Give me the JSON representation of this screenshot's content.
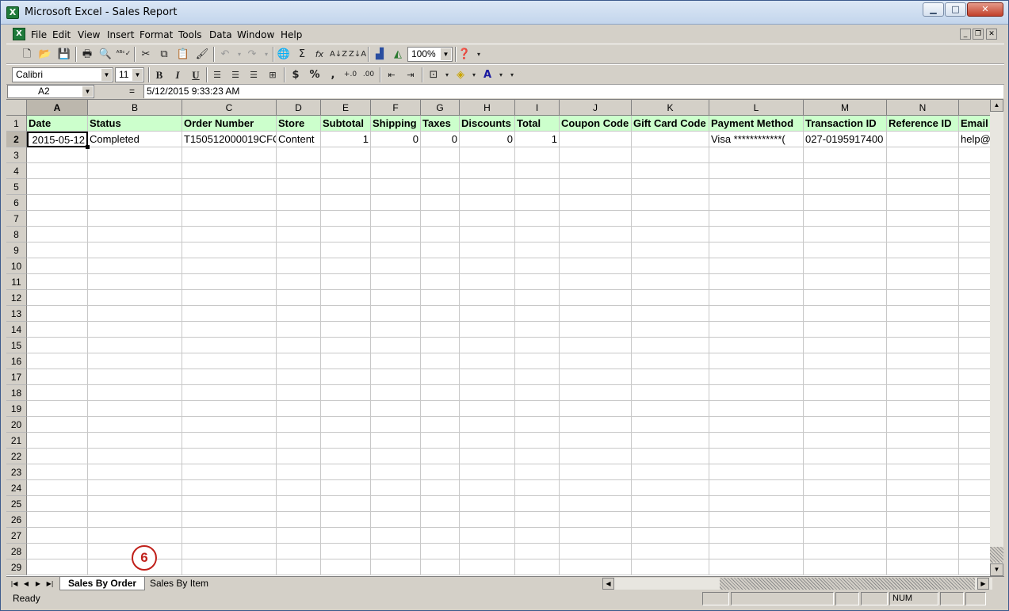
{
  "window": {
    "title": "Microsoft Excel - Sales Report"
  },
  "menu": [
    "File",
    "Edit",
    "View",
    "Insert",
    "Format",
    "Tools",
    "Data",
    "Window",
    "Help"
  ],
  "toolbar": {
    "zoom": "100%",
    "font": "Calibri",
    "font_size": "11"
  },
  "formula_bar": {
    "cell_ref": "A2",
    "equals": "=",
    "value": "5/12/2015  9:33:23 AM"
  },
  "columns": [
    "A",
    "B",
    "C",
    "D",
    "E",
    "F",
    "G",
    "H",
    "I",
    "J",
    "K",
    "L",
    "M",
    "N",
    ""
  ],
  "header_row": [
    "Date",
    "Status",
    "Order Number",
    "Store",
    "Subtotal",
    "Shipping",
    "Taxes",
    "Discounts",
    "Total",
    "Coupon Code",
    "Gift Card Code",
    "Payment Method",
    "Transaction ID",
    "Reference ID",
    "Email"
  ],
  "data_row": [
    "2015-05-12",
    "Completed",
    "T150512000019CFC",
    "Content",
    "1",
    "0",
    "0",
    "0",
    "1",
    "",
    "",
    "Visa ************(",
    "027-0195917400",
    "",
    "help@"
  ],
  "row_numbers": [
    "1",
    "2",
    "3",
    "4",
    "5",
    "6",
    "7",
    "8",
    "9",
    "10",
    "11",
    "12",
    "13",
    "14",
    "15",
    "16",
    "17",
    "18",
    "19",
    "20",
    "21",
    "22",
    "23",
    "24",
    "25",
    "26",
    "27",
    "28",
    "29"
  ],
  "sheets": [
    {
      "name": "Sales By Order",
      "active": true
    },
    {
      "name": "Sales By Item",
      "active": false
    }
  ],
  "status": {
    "ready": "Ready",
    "num": "NUM"
  },
  "annotation": "6",
  "icons": {
    "app": "excel-icon",
    "new": "new-document-icon",
    "open": "open-folder-icon",
    "save": "save-icon",
    "print": "print-icon",
    "preview": "print-preview-icon",
    "spell": "spellcheck-icon",
    "cut": "cut-icon",
    "copy": "copy-icon",
    "paste": "paste-icon",
    "format_painter": "format-painter-icon",
    "undo": "undo-icon",
    "redo": "redo-icon",
    "hyperlink": "hyperlink-icon",
    "autosum": "autosum-icon",
    "function": "function-icon",
    "sort_asc": "sort-ascending-icon",
    "sort_desc": "sort-descending-icon",
    "chart": "chart-wizard-icon",
    "drawing": "drawing-icon",
    "help": "help-icon"
  }
}
